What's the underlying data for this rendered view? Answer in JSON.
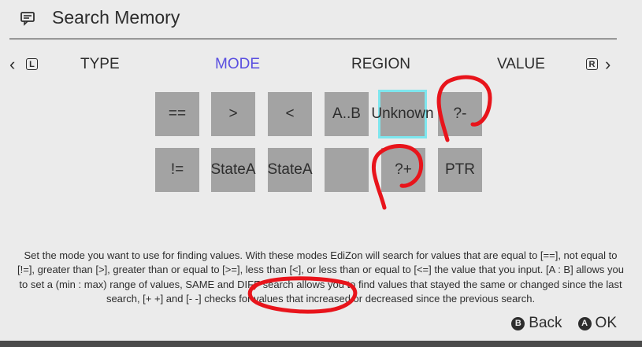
{
  "header": {
    "title": "Search Memory",
    "icon": "search-memory-icon"
  },
  "tabs": {
    "left_key": "L",
    "right_key": "R",
    "items": [
      {
        "label": "TYPE",
        "active": false
      },
      {
        "label": "MODE",
        "active": true
      },
      {
        "label": "REGION",
        "active": false
      },
      {
        "label": "VALUE",
        "active": false
      }
    ]
  },
  "modes": {
    "row1": [
      "==",
      ">",
      "<",
      "A..B",
      "Unknown",
      "?-"
    ],
    "row2": [
      "!=",
      "StateA",
      "StateA",
      "",
      "?+",
      "PTR"
    ],
    "selected": "Unknown"
  },
  "description": "Set the mode you want to use for finding values. With these modes EdiZon will search for values that are equal to [==], not equal to [!=], greater than [>], greater than or equal to [>=], less than [<], or less than or equal to [<=] the value that you input. [A : B] allows you to set a (min : max) range of values, SAME and DIFF search allows you to find values that stayed the same or changed since the last search, [+ +] and [- -] checks for values that increased or decreased since the previous search.",
  "footer": {
    "back_glyph": "B",
    "back_label": "Back",
    "ok_glyph": "A",
    "ok_label": "OK"
  },
  "colors": {
    "background": "#ebebeb",
    "active_tab": "#5a4fe0",
    "cell": "#a3a3a3",
    "selection": "#7ee6ee",
    "annotation": "#e8141b"
  }
}
